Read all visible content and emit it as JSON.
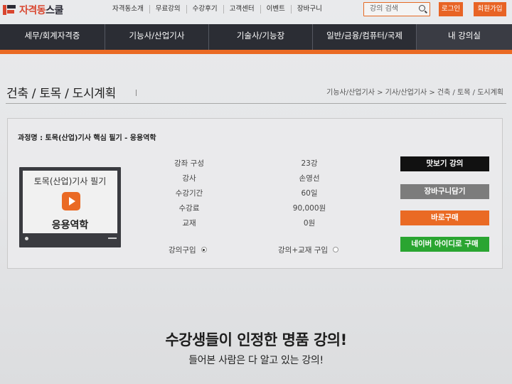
{
  "header": {
    "logo_text_orange": "자격동",
    "logo_text_dark": "스쿨",
    "nav": [
      "자격동소개",
      "무료강의",
      "수강후기",
      "고객센터",
      "이벤트",
      "장바구니"
    ],
    "search_placeholder": "강의 검색",
    "search_icon": "search-icon",
    "login_label": "로그인",
    "join_label": "회원가입"
  },
  "main_nav": [
    "세무/회계자격증",
    "기능사/산업기사",
    "기술사/기능장",
    "일반/금융/컴퓨터/국제",
    "내 강의실"
  ],
  "page": {
    "title": "건축 / 토목 / 도시계획",
    "breadcrumb": "기능사/산업기사 > 기사/산업기사 > 건축 / 토목 / 도시계획"
  },
  "course": {
    "name": "과정명 : 토목(산업)기사 핵심 필기 - 응용역학",
    "thumb_title": "토목(산업)기사 필기",
    "thumb_subtitle": "응용역학",
    "info": [
      {
        "label": "강좌 구성",
        "value": "23강"
      },
      {
        "label": "강사",
        "value": "손영선"
      },
      {
        "label": "수강기간",
        "value": "60일"
      },
      {
        "label": "수강료",
        "value": "90,000원"
      },
      {
        "label": "교재",
        "value": "0원"
      }
    ],
    "options": [
      {
        "label": "강의구입",
        "selected": true
      },
      {
        "label": "강의+교재 구입",
        "selected": false
      }
    ],
    "actions": {
      "preview": "맛보기 강의",
      "cart": "장바구니담기",
      "buy": "바로구매",
      "naver": "네이버 아이디로 구매"
    }
  },
  "promo": {
    "headline": "수강생들이 인정한 명품 강의!",
    "subline": "들어본 사람은 다 알고 있는 강의!"
  },
  "colors": {
    "accent": "#ea6a24",
    "nav_bg": "#2b2d34",
    "naver_green": "#2aa531"
  }
}
